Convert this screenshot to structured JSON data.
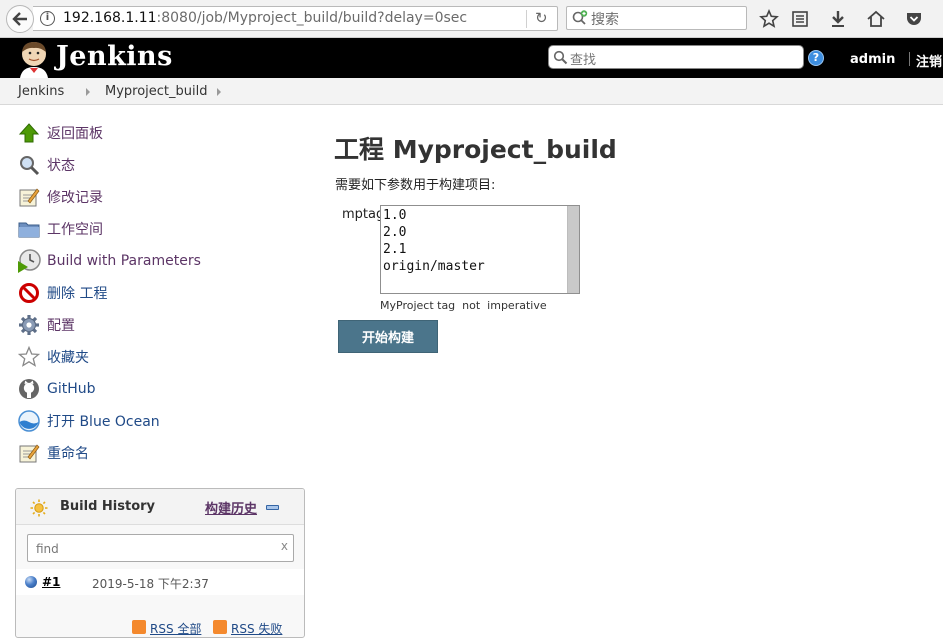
{
  "browser": {
    "url_host": "192.168.1.11",
    "url_rest": ":8080/job/Myproject_build/build?delay=0sec",
    "search_placeholder": "搜索"
  },
  "header": {
    "logo_text": "Jenkins",
    "search_placeholder": "查找",
    "user": "admin",
    "logout": "注销"
  },
  "breadcrumb": [
    "Jenkins",
    "Myproject_build"
  ],
  "sidebar": {
    "items": [
      {
        "label": "返回面板",
        "icon": "up-arrow-icon"
      },
      {
        "label": "状态",
        "icon": "magnifier-icon"
      },
      {
        "label": "修改记录",
        "icon": "notepad-icon"
      },
      {
        "label": "工作空间",
        "icon": "folder-icon"
      },
      {
        "label": "Build with Parameters",
        "icon": "clock-play-icon"
      },
      {
        "label": "删除 工程",
        "icon": "no-entry-icon"
      },
      {
        "label": "配置",
        "icon": "gear-icon"
      },
      {
        "label": "收藏夹",
        "icon": "star-icon"
      },
      {
        "label": "GitHub",
        "icon": "github-icon"
      },
      {
        "label": "打开 Blue Ocean",
        "icon": "blue-ocean-icon"
      },
      {
        "label": "重命名",
        "icon": "notepad-icon"
      }
    ]
  },
  "build_history": {
    "title": "Build History",
    "trend_link": "构建历史",
    "filter_placeholder": "find",
    "filter_clear": "x",
    "builds": [
      {
        "number": "#1",
        "time": "2019-5-18 下午2:37",
        "status_color": "#4a7fc9"
      }
    ],
    "rss_all": "RSS 全部",
    "rss_failed": "RSS 失败"
  },
  "main": {
    "title": "工程 Myproject_build",
    "description": "需要如下参数用于构建项目:",
    "param_name": "mptag",
    "param_options": [
      "1.0",
      "2.0",
      "2.1",
      "origin/master"
    ],
    "param_help": "MyProject tag  not  imperative",
    "build_button": "开始构建"
  },
  "colors": {
    "header_bg": "#000000",
    "link": "#204a87",
    "visited_link": "#5c3566",
    "build_button": "#4b758b"
  }
}
